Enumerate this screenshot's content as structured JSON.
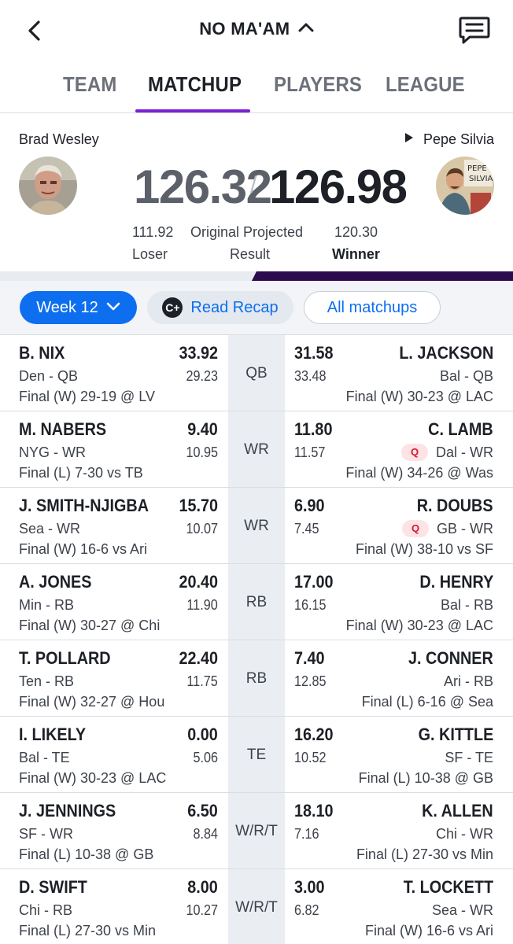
{
  "header": {
    "title": "NO MA'AM",
    "back_icon": "chevron-left-icon",
    "messages_icon": "chat-bubble-icon"
  },
  "tabs": [
    {
      "label": "TEAM",
      "active": false
    },
    {
      "label": "MATCHUP",
      "active": true
    },
    {
      "label": "PLAYERS",
      "active": false
    },
    {
      "label": "LEAGUE",
      "active": false
    }
  ],
  "matchup": {
    "left_team": "Brad Wesley",
    "right_team": "Pepe Silvia",
    "left_score": "126.32",
    "separator": "/",
    "right_score": "126.98",
    "left_projected": "111.92",
    "right_projected": "120.30",
    "center_label": "Original Projected",
    "center_sub": "Result",
    "left_result": "Loser",
    "right_result": "Winner",
    "right_team_share": 0.5
  },
  "filters": {
    "week": "Week 12",
    "recap": "Read Recap",
    "all": "All matchups"
  },
  "colors": {
    "accent_purple": "#7a1fd6",
    "primary_blue": "#0d6ef0",
    "progress_dark": "#2b0a4d",
    "questionable_red": "#d4162f"
  },
  "rows": [
    {
      "pos": "QB",
      "l_name": "B. NIX",
      "l_pts": "33.92",
      "l_team": "Den - QB",
      "l_proj": "29.23",
      "l_status": "Final (W) 29-19 @ LV",
      "r_name": "L. JACKSON",
      "r_pts": "31.58",
      "r_team": "Bal - QB",
      "r_proj": "33.48",
      "r_status": "Final (W) 30-23 @ LAC",
      "r_q": ""
    },
    {
      "pos": "WR",
      "l_name": "M. NABERS",
      "l_pts": "9.40",
      "l_team": "NYG - WR",
      "l_proj": "10.95",
      "l_status": "Final (L) 7-30 vs TB",
      "r_name": "C. LAMB",
      "r_pts": "11.80",
      "r_team": "Dal - WR",
      "r_proj": "11.57",
      "r_status": "Final (W) 34-26 @ Was",
      "r_q": "Q"
    },
    {
      "pos": "WR",
      "l_name": "J. SMITH-NJIGBA",
      "l_pts": "15.70",
      "l_team": "Sea - WR",
      "l_proj": "10.07",
      "l_status": "Final (W) 16-6 vs Ari",
      "r_name": "R. DOUBS",
      "r_pts": "6.90",
      "r_team": "GB - WR",
      "r_proj": "7.45",
      "r_status": "Final (W) 38-10 vs SF",
      "r_q": "Q"
    },
    {
      "pos": "RB",
      "l_name": "A. JONES",
      "l_pts": "20.40",
      "l_team": "Min - RB",
      "l_proj": "11.90",
      "l_status": "Final (W) 30-27 @ Chi",
      "r_name": "D. HENRY",
      "r_pts": "17.00",
      "r_team": "Bal - RB",
      "r_proj": "16.15",
      "r_status": "Final (W) 30-23 @ LAC",
      "r_q": ""
    },
    {
      "pos": "RB",
      "l_name": "T. POLLARD",
      "l_pts": "22.40",
      "l_team": "Ten - RB",
      "l_proj": "11.75",
      "l_status": "Final (W) 32-27 @ Hou",
      "r_name": "J. CONNER",
      "r_pts": "7.40",
      "r_team": "Ari - RB",
      "r_proj": "12.85",
      "r_status": "Final (L) 6-16 @ Sea",
      "r_q": ""
    },
    {
      "pos": "TE",
      "l_name": "I. LIKELY",
      "l_pts": "0.00",
      "l_team": "Bal - TE",
      "l_proj": "5.06",
      "l_status": "Final (W) 30-23 @ LAC",
      "r_name": "G. KITTLE",
      "r_pts": "16.20",
      "r_team": "SF - TE",
      "r_proj": "10.52",
      "r_status": "Final (L) 10-38 @ GB",
      "r_q": ""
    },
    {
      "pos": "W/R/T",
      "l_name": "J. JENNINGS",
      "l_pts": "6.50",
      "l_team": "SF - WR",
      "l_proj": "8.84",
      "l_status": "Final (L) 10-38 @ GB",
      "r_name": "K. ALLEN",
      "r_pts": "18.10",
      "r_team": "Chi - WR",
      "r_proj": "7.16",
      "r_status": "Final (L) 27-30 vs Min",
      "r_q": ""
    },
    {
      "pos": "W/R/T",
      "l_name": "D. SWIFT",
      "l_pts": "8.00",
      "l_team": "Chi - RB",
      "l_proj": "10.27",
      "l_status": "Final (L) 27-30 vs Min",
      "r_name": "T. LOCKETT",
      "r_pts": "3.00",
      "r_team": "Sea - WR",
      "r_proj": "6.82",
      "r_status": "Final (W) 16-6 vs Ari",
      "r_q": ""
    }
  ]
}
